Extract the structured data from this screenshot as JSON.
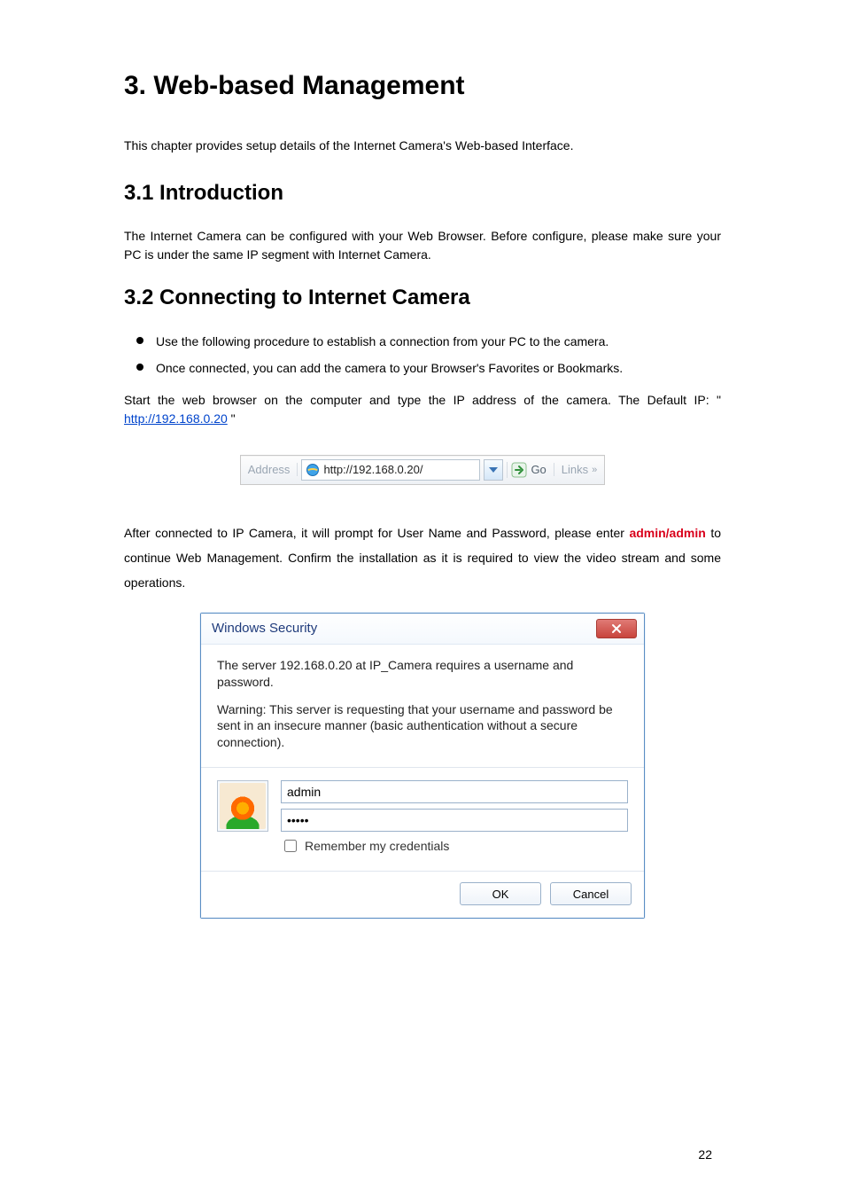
{
  "title": "3. Web-based Management",
  "intro": "This chapter provides setup details of the Internet Camera's Web-based Interface.",
  "section1_heading": "3.1 Introduction",
  "section1_body": "The Internet Camera can be configured with your Web Browser. Before configure, please make sure your PC is under the same IP segment with Internet Camera.",
  "section2_heading": "3.2 Connecting to Internet Camera",
  "bullets": [
    "Use the following procedure to establish a connection from your PC to the camera.",
    "Once connected, you can add the camera to your Browser's Favorites or Bookmarks."
  ],
  "para_start_prefix": "Start the web browser on the computer and type the IP address of the camera. The Default IP: \" ",
  "url_text": "http://192.168.0.20",
  "para_start_suffix": " \"",
  "addressbar": {
    "label": "Address",
    "url": "http://192.168.0.20/",
    "go_label": "Go",
    "links_label": "Links"
  },
  "after_para_lead": "After connected to IP Camera, it",
  "after_para_mid1": " will prompt for User Name and Password, please enter ",
  "cred_text": "admin/admin",
  "after_para_mid2": " to continue Web Management. Confirm the installation as it is required to view the video stream and some operations.",
  "dialog": {
    "title": "Windows Security",
    "line1": "The server 192.168.0.20 at IP_Camera requires a username and password.",
    "line2": "Warning: This server is requesting that your username and password be sent in an insecure manner (basic authentication without a secure connection).",
    "username_value": "admin",
    "password_value": "•••••",
    "remember_label": "Remember my credentials",
    "ok_label": "OK",
    "cancel_label": "Cancel"
  },
  "page_number": "22"
}
